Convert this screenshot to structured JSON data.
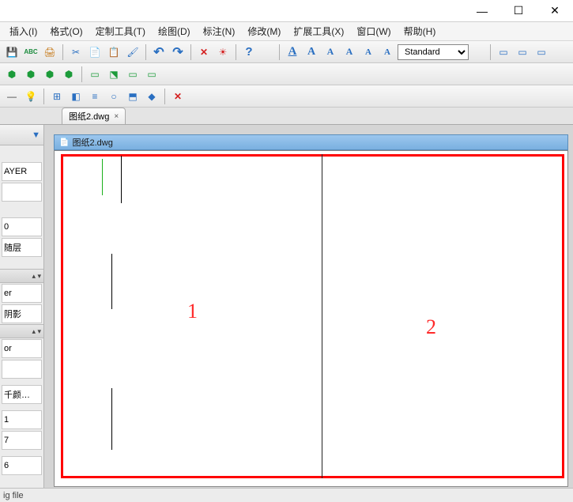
{
  "window": {
    "min": "—",
    "max": "☐",
    "close": "✕"
  },
  "menu": {
    "insert": "插入(I)",
    "format": "格式(O)",
    "custom_tools": "定制工具(T)",
    "draw": "绘图(D)",
    "annotate": "标注(N)",
    "modify": "修改(M)",
    "ext_tools": "扩展工具(X)",
    "window": "窗口(W)",
    "help": "帮助(H)"
  },
  "toolbar1": {
    "save_icon": "💾",
    "spell_icon": "ABC",
    "print_icon": "🖨",
    "cut_icon": "✂",
    "copy_icon": "📄",
    "paste_icon": "📋",
    "format_painter_icon": "🖌",
    "undo_icon": "↶",
    "redo_icon": "↷",
    "delete_icon": "✕",
    "sun_icon": "☀",
    "help_icon": "?",
    "text_a1": "A",
    "text_a2": "A",
    "text_a3": "A",
    "text_a4": "A",
    "text_a5": "A",
    "text_a6": "A",
    "style_value": "Standard",
    "align1_icon": "▭",
    "align2_icon": "▭",
    "align3_icon": "▭"
  },
  "toolbar2": {
    "g1": "⬢",
    "g2": "⬢",
    "g3": "⬢",
    "g4": "⬢",
    "g5": "▭",
    "g6": "⬔",
    "g7": "▭",
    "g8": "▭"
  },
  "toolbar3": {
    "b1": "—",
    "b2": "💡",
    "b3": "⊞",
    "b4": "◧",
    "b5": "≡",
    "b6": "○",
    "b7": "⬒",
    "b8": "◆",
    "b9": "✕"
  },
  "doc_tab": {
    "label": "图纸2.dwg",
    "close": "×"
  },
  "canvas": {
    "title": "图纸2.dwg",
    "num1": "1",
    "num2": "2"
  },
  "side": {
    "filter_icon": "▼",
    "row_layer": "AYER",
    "row_0": "0",
    "row_bylayer": "随层",
    "row_er": "er",
    "row_shadow": "阴影",
    "row_or": "or",
    "row_color": "千颜…",
    "row_1": "1",
    "row_7": "7",
    "row_6": "6",
    "section_caret": "▴ ▾"
  },
  "status": {
    "text": "ig file"
  }
}
